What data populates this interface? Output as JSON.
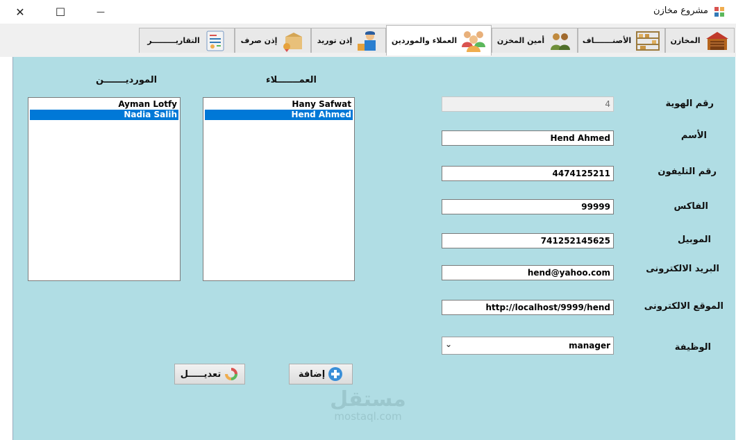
{
  "window": {
    "title": "مشروع مخازن",
    "close_glyph": "✕",
    "maximize_glyph": "☐",
    "minimize_glyph": "—"
  },
  "tabs": [
    {
      "label": "المخازن",
      "icon": "warehouse-icon",
      "active": false
    },
    {
      "label": "الأصنـــــــاف",
      "icon": "shelves-icon",
      "active": false
    },
    {
      "label": "أمين المخزن",
      "icon": "users-group-icon",
      "active": false
    },
    {
      "label": "العملاء والموردين",
      "icon": "people-icon",
      "active": true
    },
    {
      "label": "إذن توريد",
      "icon": "delivery-worker-icon",
      "active": false
    },
    {
      "label": "إذن صرف",
      "icon": "box-ribbon-icon",
      "active": false
    },
    {
      "label": "التقاريـــــــــر",
      "icon": "report-icon",
      "active": false
    }
  ],
  "form": {
    "id_label": "رقم الهوية",
    "id_value": "4",
    "name_label": "الأسم",
    "name_value": "Hend Ahmed",
    "phone_label": "رقم التليفون",
    "phone_value": "4474125211",
    "fax_label": "الفاكس",
    "fax_value": "99999",
    "mobile_label": "الموبيل",
    "mobile_value": "741252145625",
    "email_label": "البريد الالكترونى",
    "email_value": "hend@yahoo.com",
    "website_label": "الموقع الالكترونى",
    "website_value": "http://localhost/9999/hend",
    "job_label": "الوظيفة",
    "job_value": "manager"
  },
  "customers": {
    "header": "العمـــــــلاء",
    "items": [
      "Hany Safwat",
      "Hend Ahmed"
    ],
    "selected": 1
  },
  "suppliers": {
    "header": "الموردیـــــــن",
    "items": [
      "Ayman Lotfy",
      "Nadia Salih"
    ],
    "selected": 1
  },
  "buttons": {
    "add_label": "إضافة",
    "edit_label": "تعديـــــل"
  },
  "watermark": {
    "arabic": "مستقل",
    "latin": "mostaql.com"
  },
  "colors": {
    "panel": "#b0dde4",
    "selection": "#0078d7"
  }
}
